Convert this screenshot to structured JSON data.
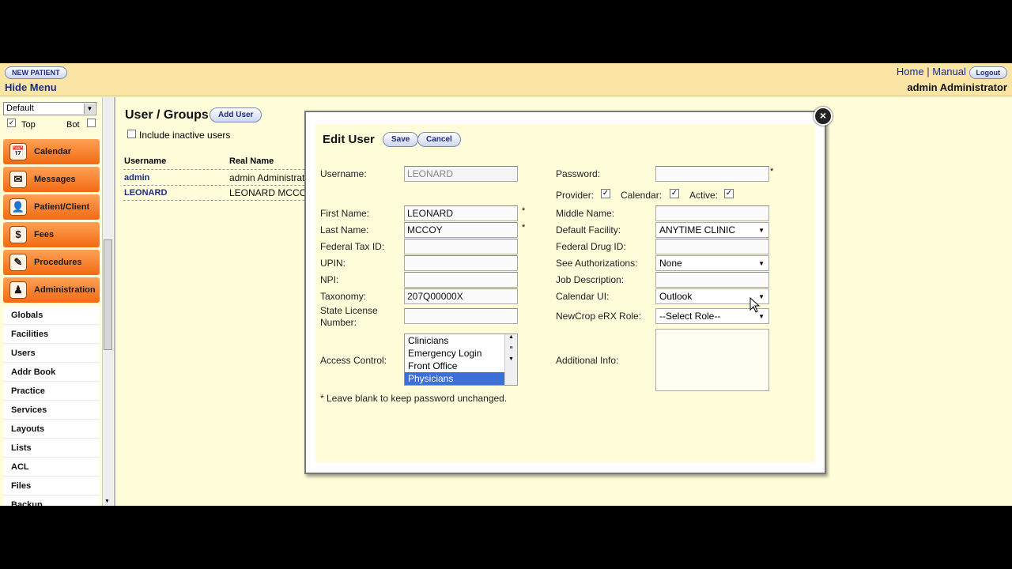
{
  "topbar": {
    "new_patient": "NEW PATIENT",
    "hide_menu": "Hide Menu",
    "home": "Home",
    "separator": "|",
    "manual": "Manual",
    "logout": "Logout",
    "user_name": "admin Administrator"
  },
  "leftnav": {
    "menu_select": "Default",
    "top_label": "Top",
    "bot_label": "Bot",
    "main_items": [
      {
        "label": "Calendar",
        "icon": "calendar-icon"
      },
      {
        "label": "Messages",
        "icon": "messages-icon"
      },
      {
        "label": "Patient/Client",
        "icon": "patient-icon"
      },
      {
        "label": "Fees",
        "icon": "fees-icon"
      },
      {
        "label": "Procedures",
        "icon": "procedures-icon"
      },
      {
        "label": "Administration",
        "icon": "administration-icon"
      }
    ],
    "sub_items": [
      "Globals",
      "Facilities",
      "Users",
      "Addr Book",
      "Practice",
      "Services",
      "Layouts",
      "Lists",
      "ACL",
      "Files",
      "Backup"
    ]
  },
  "users_panel": {
    "title": "User / Groups",
    "add_user": "Add User",
    "include_inactive": "Include inactive users",
    "columns": [
      "Username",
      "Real Name"
    ],
    "rows": [
      {
        "username": "admin",
        "real_name": "admin Administrator"
      },
      {
        "username": "LEONARD",
        "real_name": "LEONARD MCCOY"
      }
    ]
  },
  "edit_user": {
    "title": "Edit User",
    "save": "Save",
    "cancel": "Cancel",
    "close": "×",
    "required_mark": "*",
    "labels": {
      "username": "Username:",
      "password": "Password:",
      "provider": "Provider:",
      "calendar": "Calendar:",
      "active": "Active:",
      "first_name": "First Name:",
      "middle_name": "Middle Name:",
      "last_name": "Last Name:",
      "default_facility": "Default Facility:",
      "federal_tax_id": "Federal Tax ID:",
      "federal_drug_id": "Federal Drug ID:",
      "upin": "UPIN:",
      "see_authorizations": "See Authorizations:",
      "npi": "NPI:",
      "job_description": "Job Description:",
      "taxonomy": "Taxonomy:",
      "calendar_ui": "Calendar UI:",
      "state_license_1": "State License",
      "state_license_2": "Number:",
      "newcrop_role": "NewCrop eRX Role:",
      "access_control": "Access Control:",
      "additional_info": "Additional Info:"
    },
    "values": {
      "username": "LEONARD",
      "password": "",
      "provider": true,
      "calendar": true,
      "active": true,
      "first_name": "LEONARD",
      "middle_name": "",
      "last_name": "MCCOY",
      "default_facility": "ANYTIME CLINIC",
      "federal_tax_id": "",
      "federal_drug_id": "",
      "upin": "",
      "see_authorizations": "None",
      "npi": "",
      "job_description": "",
      "taxonomy": "207Q00000X",
      "calendar_ui": "Outlook",
      "state_license": "",
      "newcrop_role": "--Select Role--",
      "additional_info": ""
    },
    "access_control_options": [
      "Clinicians",
      "Emergency Login",
      "Front Office",
      "Physicians"
    ],
    "access_control_selected": "Physicians",
    "password_note": "* Leave blank to keep password unchanged."
  }
}
